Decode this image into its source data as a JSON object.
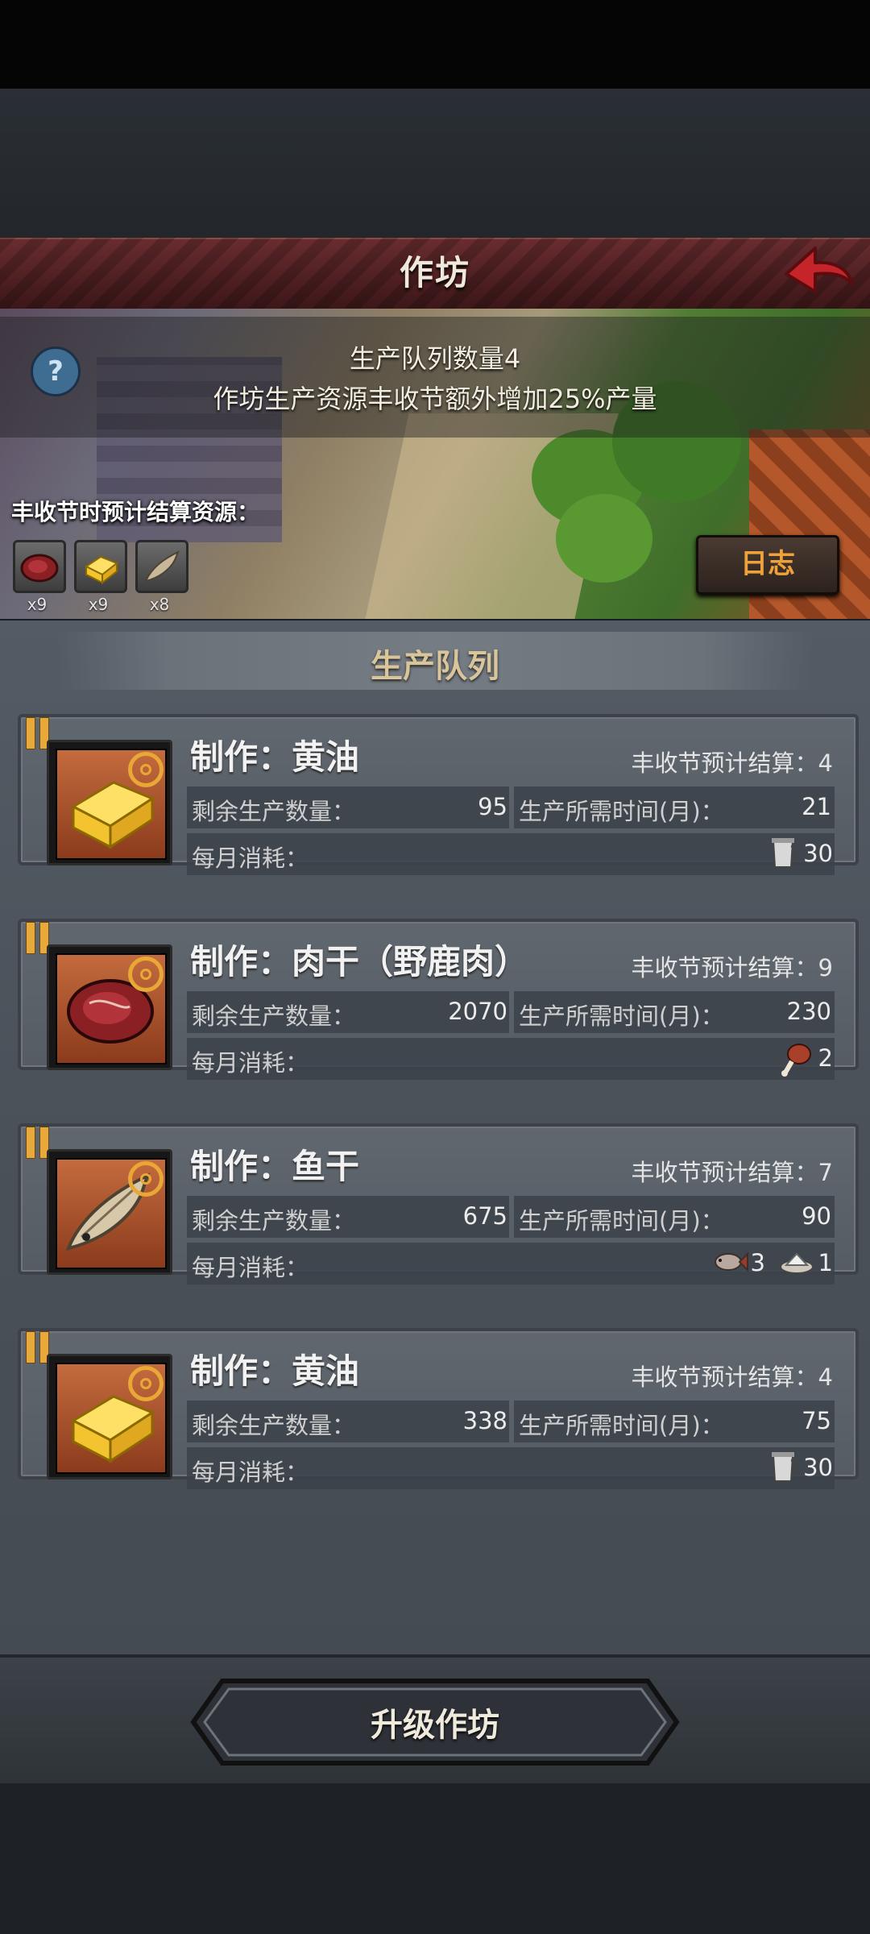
{
  "header": {
    "title": "作坊"
  },
  "banner": {
    "line1": "生产队列数量4",
    "line2": "作坊生产资源丰收节额外增加25%产量",
    "harvest_label": "丰收节时预计结算资源：",
    "resources": [
      {
        "icon": "meat-icon",
        "count": "x9"
      },
      {
        "icon": "butter-icon",
        "count": "x9"
      },
      {
        "icon": "dried-fish-icon",
        "count": "x8"
      }
    ],
    "help_label": "?",
    "log_label": "日志"
  },
  "queue": {
    "title": "生产队列",
    "remaining_label": "剩余生产数量：",
    "time_label": "生产所需时间(月)：",
    "consume_label": "每月消耗：",
    "items": [
      {
        "title": "制作：黄油",
        "harvest": "丰收节预计结算：4",
        "remaining": "95",
        "months": "21",
        "icon": "butter-icon",
        "consume": [
          {
            "icon": "milk-jug-icon",
            "amount": "30"
          }
        ]
      },
      {
        "title": "制作：肉干（野鹿肉）",
        "harvest": "丰收节预计结算：9",
        "remaining": "2070",
        "months": "230",
        "icon": "meat-icon",
        "consume": [
          {
            "icon": "drumstick-icon",
            "amount": "2"
          }
        ]
      },
      {
        "title": "制作：鱼干",
        "harvest": "丰收节预计结算：7",
        "remaining": "675",
        "months": "90",
        "icon": "dried-fish-icon",
        "consume": [
          {
            "icon": "fish-icon",
            "amount": "3"
          },
          {
            "icon": "salt-icon",
            "amount": "1"
          }
        ]
      },
      {
        "title": "制作：黄油",
        "harvest": "丰收节预计结算：4",
        "remaining": "338",
        "months": "75",
        "icon": "butter-icon",
        "consume": [
          {
            "icon": "milk-jug-icon",
            "amount": "30"
          }
        ]
      }
    ]
  },
  "footer": {
    "upgrade_label": "升级作坊"
  },
  "colors": {
    "accent": "#e7a93a",
    "title_bar": "#5a2528",
    "log_text": "#f0a23a"
  }
}
